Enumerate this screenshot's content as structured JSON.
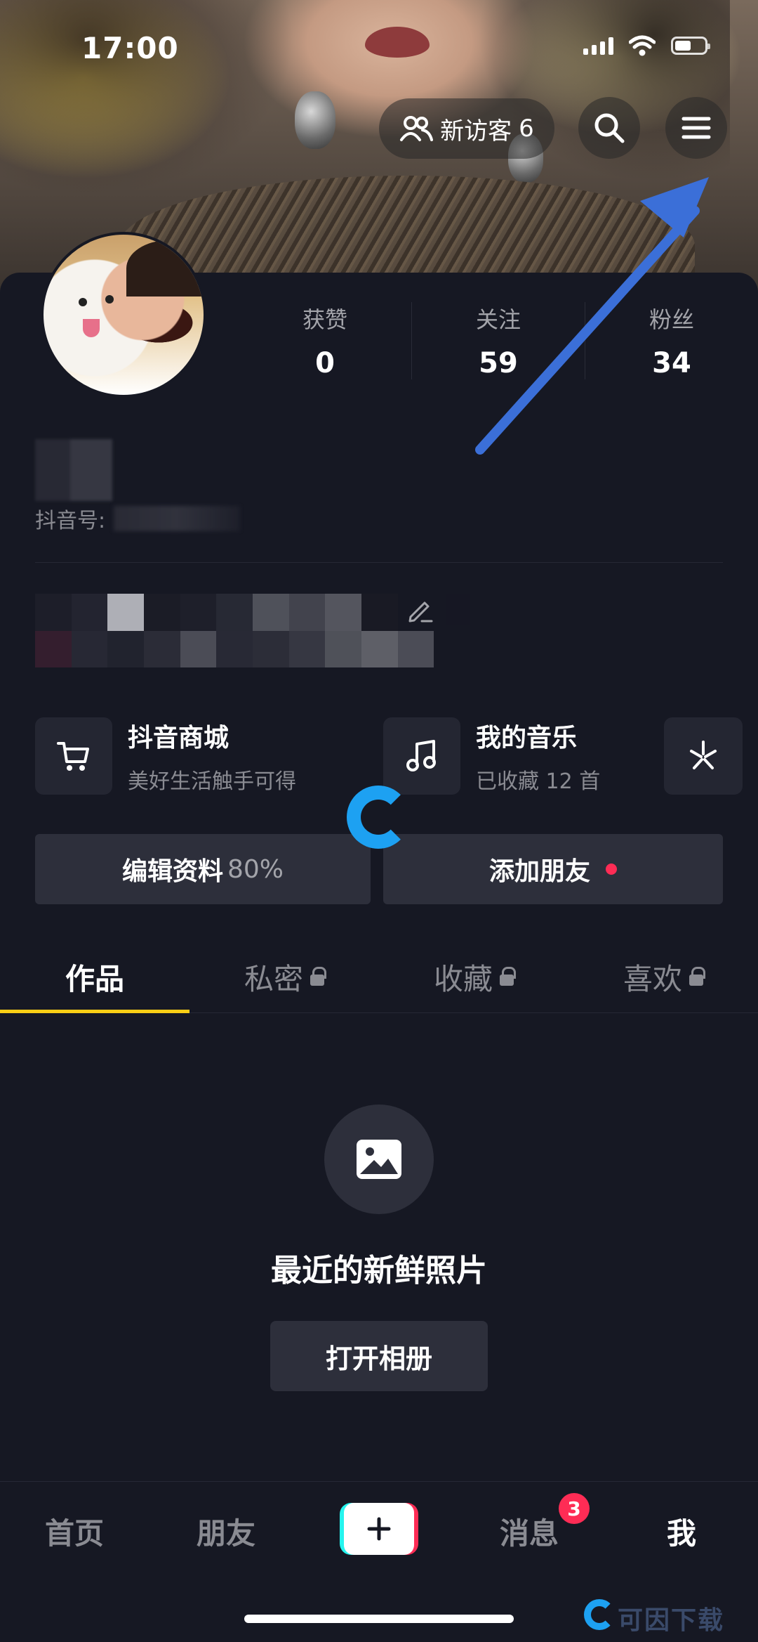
{
  "status_bar": {
    "time": "17:00"
  },
  "header": {
    "visitor_label": "新访客",
    "visitor_count": "6"
  },
  "profile": {
    "stats": [
      {
        "label": "获赞",
        "value": "0"
      },
      {
        "label": "关注",
        "value": "59"
      },
      {
        "label": "粉丝",
        "value": "34"
      }
    ],
    "douyin_id_label": "抖音号:"
  },
  "features": {
    "shop": {
      "title": "抖音商城",
      "subtitle": "美好生活触手可得"
    },
    "music": {
      "title": "我的音乐",
      "subtitle": "已收藏 12 首"
    }
  },
  "actions": {
    "edit_profile": "编辑资料",
    "edit_profile_progress": "80%",
    "add_friend": "添加朋友"
  },
  "tabs": [
    {
      "label": "作品",
      "locked": false
    },
    {
      "label": "私密",
      "locked": true
    },
    {
      "label": "收藏",
      "locked": true
    },
    {
      "label": "喜欢",
      "locked": true
    }
  ],
  "empty_state": {
    "title": "最近的新鲜照片",
    "button": "打开相册"
  },
  "bottom_nav": {
    "home": "首页",
    "friends": "朋友",
    "messages": "消息",
    "messages_badge": "3",
    "me": "我"
  },
  "watermark": "可因下载",
  "colors": {
    "accent_tab": "#face15",
    "badge": "#fe2c55",
    "arrow": "#3b6fd8",
    "background": "#161823"
  }
}
